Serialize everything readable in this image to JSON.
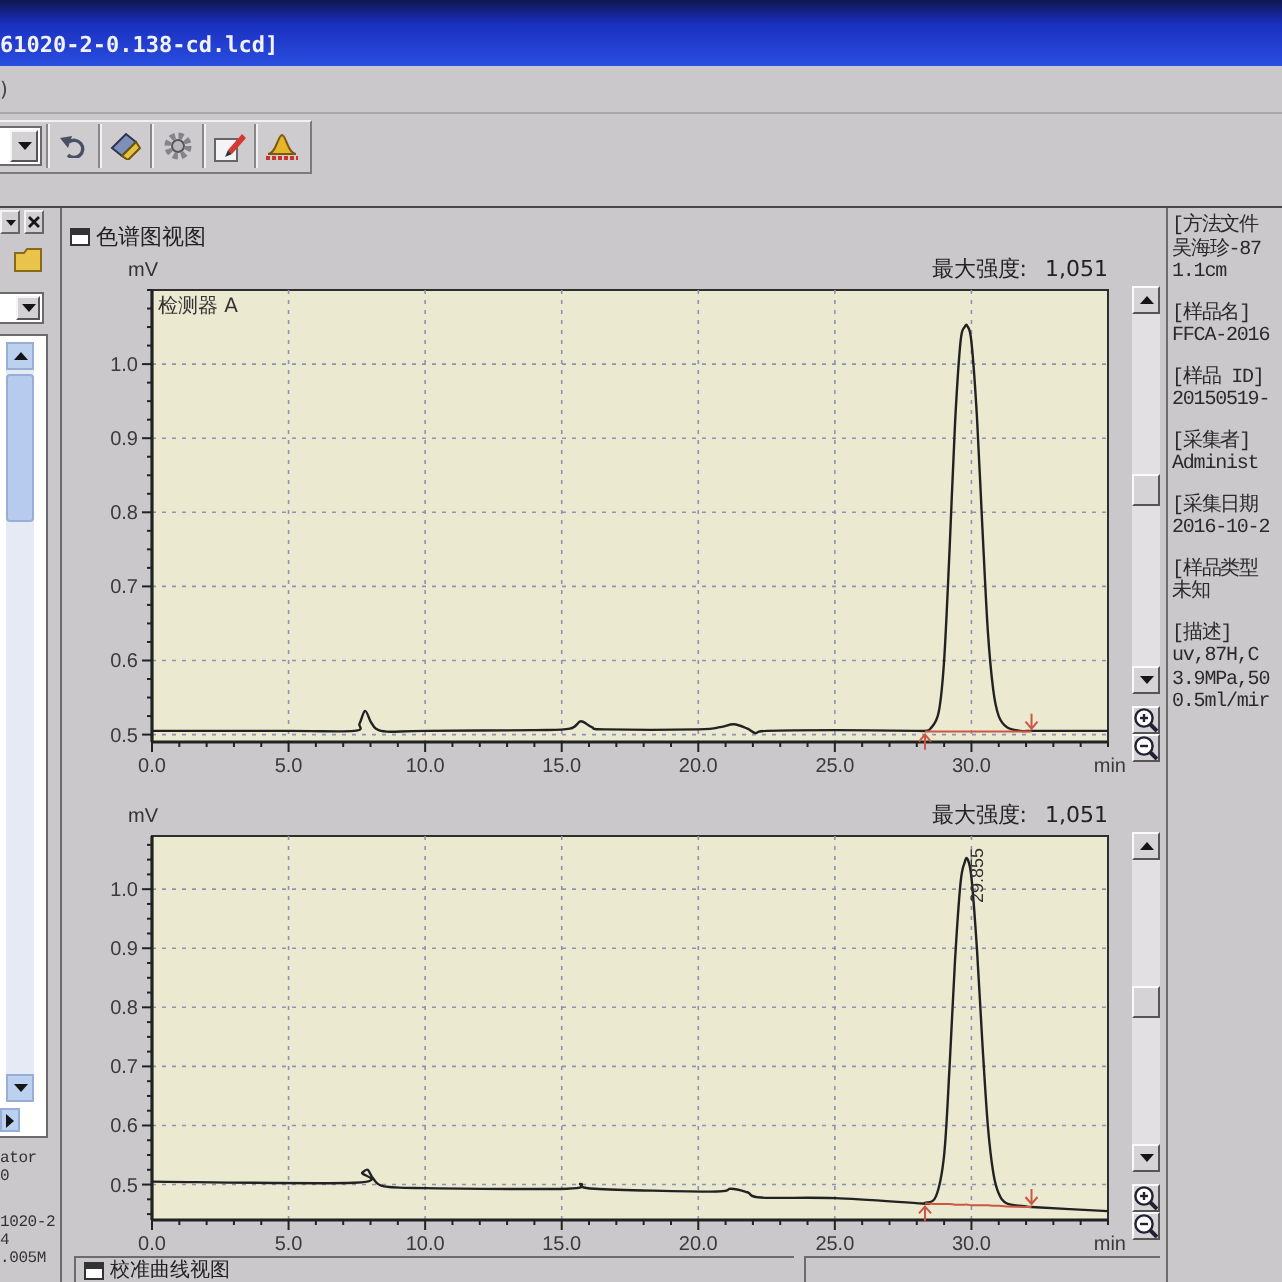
{
  "title_bar": {
    "title": "61020-2-0.138-cd.lcd]"
  },
  "menu_bar": {
    "items": [
      ")"
    ]
  },
  "left_panel": {
    "text_blocks": [
      [
        "ator",
        "0"
      ],
      [
        "1020-2",
        "4",
        ".005M"
      ]
    ]
  },
  "chromatogram_view": {
    "title": "色谱图视图",
    "charts": [
      {
        "max_intensity_label": "最大强度:",
        "max_intensity_value": "1,051",
        "chart_data": {
          "type": "line",
          "xlabel": "min",
          "ylabel": "mV",
          "grid": true,
          "x": [
            0,
            5,
            7.4,
            7.6,
            7.8,
            8.0,
            8.2,
            8.6,
            10,
            14,
            15.3,
            15.7,
            16.1,
            16.6,
            20,
            20.8,
            21.3,
            21.8,
            22.1,
            22.5,
            25,
            28,
            28.3,
            28.5,
            28.8,
            29.0,
            29.2,
            29.4,
            29.6,
            29.75,
            29.855,
            30.0,
            30.2,
            30.4,
            30.6,
            30.8,
            31.0,
            31.3,
            31.8,
            32.2,
            33,
            35
          ],
          "series": [
            {
              "name": "检测器 A",
              "color": "#222222",
              "values": [
                0.505,
                0.505,
                0.505,
                0.515,
                0.532,
                0.518,
                0.508,
                0.504,
                0.505,
                0.506,
                0.508,
                0.518,
                0.51,
                0.507,
                0.507,
                0.51,
                0.514,
                0.508,
                0.502,
                0.505,
                0.506,
                0.505,
                0.505,
                0.508,
                0.53,
                0.6,
                0.75,
                0.92,
                1.03,
                1.05,
                1.051,
                1.03,
                0.93,
                0.78,
                0.64,
                0.56,
                0.525,
                0.51,
                0.505,
                0.505,
                0.505,
                0.505
              ]
            },
            {
              "color": "#cc5644",
              "values": [
                null,
                null,
                null,
                null,
                null,
                null,
                null,
                null,
                null,
                null,
                null,
                null,
                null,
                null,
                null,
                null,
                null,
                null,
                null,
                null,
                null,
                null,
                0.504,
                0.504,
                0.504,
                0.504,
                0.504,
                0.504,
                0.504,
                0.504,
                0.504,
                0.504,
                0.504,
                0.504,
                0.504,
                0.504,
                0.504,
                0.504,
                0.504,
                0.504,
                null,
                null
              ]
            }
          ],
          "xlim": [
            0,
            35
          ],
          "ylim": [
            0.49,
            1.1
          ],
          "xticks": [
            {
              "value": 0,
              "label": "0.0"
            },
            {
              "value": 5,
              "label": "5.0"
            },
            {
              "value": 10,
              "label": "10.0"
            },
            {
              "value": 15,
              "label": "15.0"
            },
            {
              "value": 20,
              "label": "20.0"
            },
            {
              "value": 25,
              "label": "25.0"
            },
            {
              "value": 30,
              "label": "30.0"
            }
          ],
          "yticks": [
            0.5,
            0.6,
            0.7,
            0.8,
            0.9,
            {
              "value": 1.0,
              "label": "1.0"
            }
          ]
        }
      },
      {
        "max_intensity_label": "最大强度:",
        "max_intensity_value": "1,051",
        "chart_data": {
          "type": "line",
          "xlabel": "min",
          "ylabel": "mV",
          "grid": true,
          "x": [
            0,
            7.4,
            7.7,
            7.9,
            8.1,
            8.5,
            10,
            15.2,
            15.7,
            16.2,
            20.5,
            21.2,
            21.8,
            22.3,
            25,
            28.2,
            28.3,
            28.7,
            29.0,
            29.2,
            29.4,
            29.6,
            29.75,
            29.855,
            30.0,
            30.2,
            30.4,
            30.6,
            30.8,
            31.0,
            31.3,
            32,
            32.2,
            35
          ],
          "series": [
            {
              "color": "#222222",
              "values": [
                0.505,
                0.503,
                0.52,
                0.525,
                0.51,
                0.497,
                0.494,
                0.493,
                0.501,
                0.493,
                0.488,
                0.493,
                0.487,
                0.478,
                0.477,
                0.468,
                0.469,
                0.48,
                0.55,
                0.7,
                0.88,
                1.01,
                1.045,
                1.051,
                1.02,
                0.9,
                0.74,
                0.6,
                0.52,
                0.485,
                0.468,
                0.463,
                0.462,
                0.455
              ]
            },
            {
              "color": "#cc5644",
              "values": [
                null,
                null,
                null,
                null,
                null,
                null,
                null,
                null,
                null,
                null,
                null,
                null,
                null,
                null,
                null,
                null,
                0.468,
                0.467,
                0.467,
                0.467,
                0.466,
                0.466,
                0.466,
                0.466,
                0.465,
                0.465,
                0.465,
                0.465,
                0.464,
                0.464,
                0.463,
                0.462,
                0.462,
                null
              ]
            }
          ],
          "xlim": [
            0,
            35
          ],
          "ylim": [
            0.44,
            1.09
          ],
          "xticks": [
            {
              "value": 0,
              "label": "0.0"
            },
            {
              "value": 5,
              "label": "5.0"
            },
            {
              "value": 10,
              "label": "10.0"
            },
            {
              "value": 15,
              "label": "15.0"
            },
            {
              "value": 20,
              "label": "20.0"
            },
            {
              "value": 25,
              "label": "25.0"
            },
            {
              "value": 30,
              "label": "30.0"
            }
          ],
          "yticks": [
            0.5,
            0.6,
            0.7,
            0.8,
            0.9,
            {
              "value": 1.0,
              "label": "1.0"
            }
          ],
          "annotations": [
            {
              "text": "29.855"
            }
          ]
        }
      }
    ]
  },
  "info_panel": {
    "fields": [
      {
        "label": "[方法文件",
        "lines": [
          "吴海珍-87",
          "1.1cm"
        ]
      },
      {
        "label": "[样品名]",
        "lines": [
          "FFCA-2016"
        ]
      },
      {
        "label": "[样品 ID]",
        "lines": [
          "20150519-"
        ]
      },
      {
        "label": "[采集者]",
        "lines": [
          "Administ"
        ]
      },
      {
        "label": "[采集日期",
        "lines": [
          "2016-10-2"
        ]
      },
      {
        "label": "[样品类型",
        "lines": [
          "未知"
        ]
      },
      {
        "label": "[描述]",
        "lines": [
          "uv,87H,C",
          "3.9MPa,50",
          "0.5ml/mir"
        ]
      }
    ]
  },
  "bottom_panels": [
    {
      "title": "校准曲线视图"
    }
  ]
}
